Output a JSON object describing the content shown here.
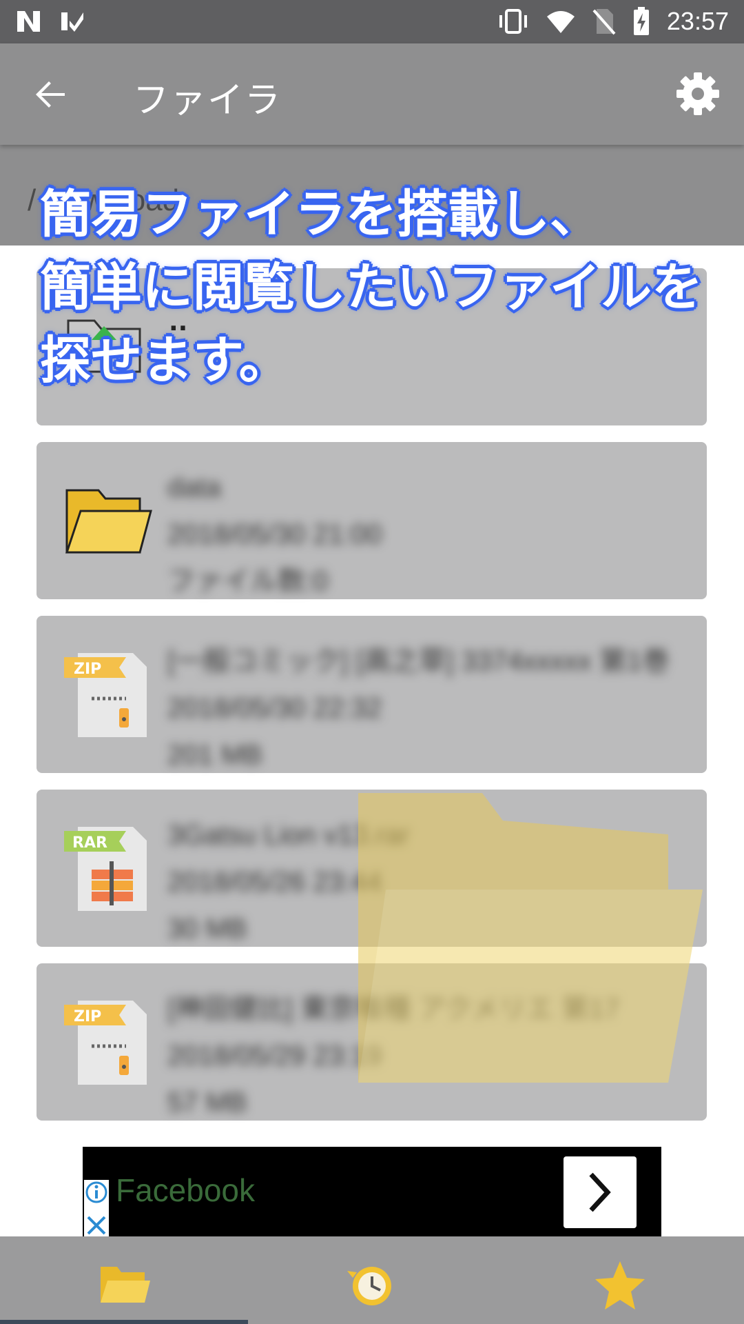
{
  "status_bar": {
    "time": "23:57",
    "icons": [
      "n-notification-icon",
      "check-notification-icon",
      "vibrate-icon",
      "wifi-icon",
      "no-sim-icon",
      "battery-charging-icon"
    ]
  },
  "app_bar": {
    "title": "ファイラ",
    "back_icon": "arrow-back-icon",
    "settings_icon": "gear-icon"
  },
  "path_bar": {
    "path": "/ Download"
  },
  "overlay": {
    "caption": "簡易ファイラを搭載し、\n簡単に閲覧したいファイルを\n探せます。"
  },
  "file_list": [
    {
      "icon": "parent-folder-icon",
      "name": "..",
      "date": "",
      "info": ""
    },
    {
      "icon": "folder-icon",
      "name": "data",
      "date": "2018/05/30 21:00",
      "info": "ファイル数:0"
    },
    {
      "icon": "zip-file-icon",
      "name": "[一般コミック] [高之草] 3374xxxxx 第1巻",
      "date": "2018/05/30 22:32",
      "info": "201 MB"
    },
    {
      "icon": "rar-file-icon",
      "name": "3Gatsu Lion v13.rar",
      "date": "2018/05/26 23:44",
      "info": "30 MB"
    },
    {
      "icon": "zip-file-icon",
      "name": "[神田健比] 東京喰種 アクメリエ 第17",
      "date": "2018/05/29 23:19",
      "info": "57 MB"
    }
  ],
  "ad": {
    "text": "Facebook",
    "info_icon": "info-icon",
    "close_icon": "close-icon",
    "arrow_icon": "chevron-right-icon"
  },
  "bottom_nav": [
    {
      "icon": "folder-icon",
      "label": "files"
    },
    {
      "icon": "history-icon",
      "label": "history"
    },
    {
      "icon": "star-icon",
      "label": "favorites"
    }
  ],
  "colors": {
    "status_bar": "#5f5f61",
    "app_bar": "#8f8f90",
    "card": "#bbbbbc",
    "caption_outline": "#3a66f0",
    "folder": "#f2c230"
  }
}
